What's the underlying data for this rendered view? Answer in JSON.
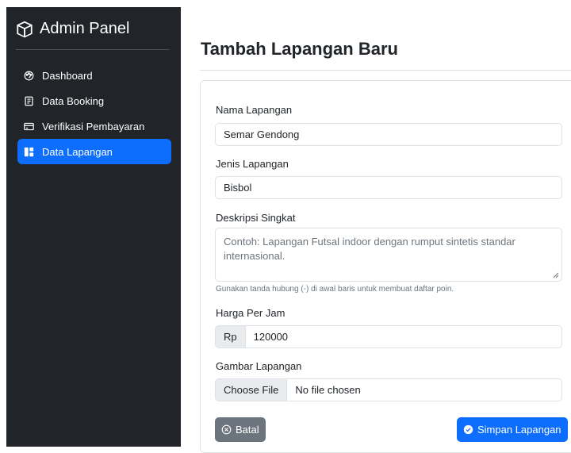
{
  "sidebar": {
    "brand": "Admin Panel",
    "items": [
      {
        "label": "Dashboard",
        "icon": "palette-icon",
        "active": false
      },
      {
        "label": "Data Booking",
        "icon": "journal-icon",
        "active": false
      },
      {
        "label": "Verifikasi Pembayaran",
        "icon": "credit-card-icon",
        "active": false
      },
      {
        "label": "Data Lapangan",
        "icon": "grid-icon",
        "active": true
      }
    ]
  },
  "page": {
    "title": "Tambah Lapangan Baru"
  },
  "form": {
    "name_label": "Nama Lapangan",
    "name_value": "Semar Gendong",
    "type_label": "Jenis Lapangan",
    "type_value": "Bisbol",
    "desc_label": "Deskripsi Singkat",
    "desc_placeholder": "Contoh: Lapangan Futsal indoor dengan rumput sintetis standar internasional.",
    "desc_hint": "Gunakan tanda hubung (-) di awal baris untuk membuat daftar poin.",
    "price_label": "Harga Per Jam",
    "price_prefix": "Rp",
    "price_value": "120000",
    "image_label": "Gambar Lapangan",
    "file_button": "Choose File",
    "file_status": "No file chosen",
    "cancel_label": "Batal",
    "save_label": "Simpan Lapangan"
  },
  "colors": {
    "sidebar_bg": "#212529",
    "accent": "#0d6efd",
    "secondary": "#6c757d"
  }
}
